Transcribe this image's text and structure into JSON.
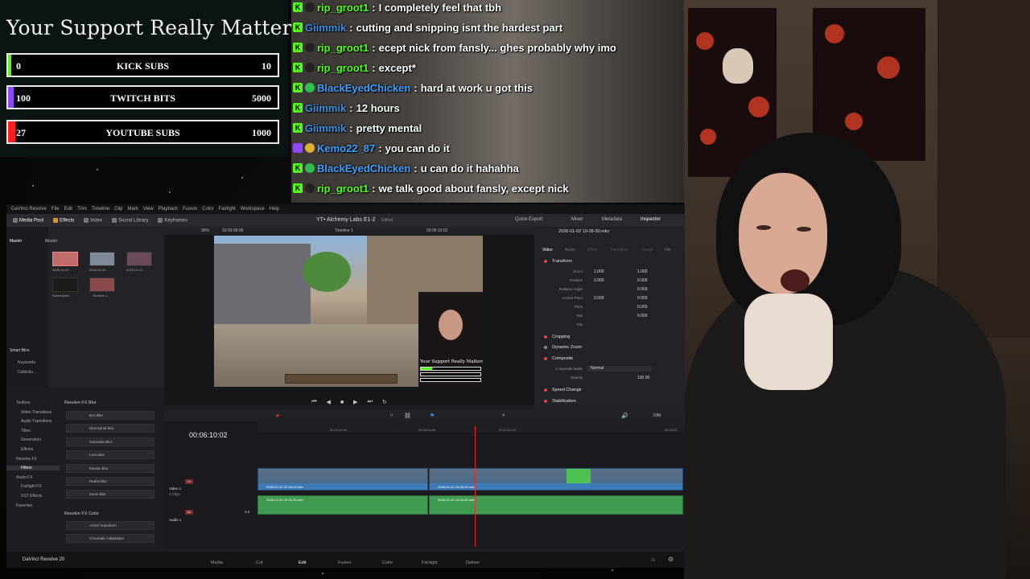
{
  "colors": {
    "kick_green": "#53fc18",
    "twitch_purple": "#9146ff",
    "youtube_red": "#ff2020",
    "resolve_bg": "#1f1f23",
    "clip_blue": "#3d7ab8",
    "clip_green": "#3f9a52",
    "playhead_red": "#e03030"
  },
  "goal": {
    "title": "Your Support Really Matters",
    "bars": [
      {
        "label": "KICK SUBS",
        "current": "0",
        "target": "10",
        "progress": 0.0
      },
      {
        "label": "TWITCH BITS",
        "current": "100",
        "target": "5000",
        "progress": 0.02
      },
      {
        "label": "YOUTUBE SUBS",
        "current": "27",
        "target": "1000",
        "progress": 0.027
      }
    ]
  },
  "chat": [
    {
      "user": "rip_groot1",
      "message": "I completely feel that tbh",
      "user_color": "#53fc18",
      "badge": "kick",
      "extra": "dark"
    },
    {
      "user": "Giimmik",
      "message": "cutting and snipping isnt the hardest part",
      "user_color": "#3c8fe0",
      "badge": "kick",
      "extra": ""
    },
    {
      "user": "rip_groot1",
      "message": "ecept nick from fansly... ghes probably why imo",
      "user_color": "#53fc18",
      "badge": "kick",
      "extra": "dark"
    },
    {
      "user": "rip_groot1",
      "message": "except*",
      "user_color": "#53fc18",
      "badge": "kick",
      "extra": "dark"
    },
    {
      "user": "BlackEyedChicken",
      "message": "hard at work u got this",
      "user_color": "#3fa0ff",
      "badge": "kick",
      "extra": "green"
    },
    {
      "user": "Giimmik",
      "message": "12 hours",
      "user_color": "#3c8fe0",
      "badge": "kick",
      "extra": ""
    },
    {
      "user": "Giimmik",
      "message": "pretty mental",
      "user_color": "#3c8fe0",
      "badge": "kick",
      "extra": ""
    },
    {
      "user": "Kemo22_87",
      "message": "you can do it",
      "user_color": "#3fa0ff",
      "badge": "twitch",
      "extra": "gold"
    },
    {
      "user": "BlackEyedChicken",
      "message": "u can do it hahahha",
      "user_color": "#3fa0ff",
      "badge": "kick",
      "extra": "green"
    },
    {
      "user": "rip_groot1",
      "message": "we talk good about fansly, except nick",
      "user_color": "#53fc18",
      "badge": "kick",
      "extra": "dark"
    }
  ],
  "resolve": {
    "app_name": "DaVinci Resolve",
    "menus": [
      "DaVinci Resolve",
      "File",
      "Edit",
      "Trim",
      "Timeline",
      "Clip",
      "Mark",
      "View",
      "Playback",
      "Fusion",
      "Color",
      "Fairlight",
      "Workspace",
      "Help"
    ],
    "toolbar": {
      "media_pool": "Media Pool",
      "effects": "Effects",
      "index": "Index",
      "sound_library": "Sound Library",
      "keyframes": "Keyframes",
      "project_title": "YT• Alchemy Labs E1-2",
      "project_state": "Edited",
      "quick_export": "Quick Export",
      "mixer": "Mixer",
      "metadata": "Metadata",
      "inspector": "Inspector"
    },
    "media_pool": {
      "bins": [
        "Master",
        "Smart Bins",
        "Keywords",
        "Collectio..."
      ],
      "master_label": "Master",
      "clips": [
        "2026-01-02...",
        "2026-01-02...",
        "2026-01-02...",
        "Screenshot...",
        "Timeline 1"
      ]
    },
    "viewer": {
      "zoom": "39%",
      "duration": "03:59:38:05",
      "timeline_name": "Timeline 1",
      "timecode": "00:06:10:02",
      "overlay_title": "Your Support Really Matters"
    },
    "inspector": {
      "file": "2026-01-02 19-28-30.mkv",
      "tabs": [
        "Video",
        "Audio",
        "Effect",
        "Transition",
        "Image",
        "File"
      ],
      "transform_title": "Transform",
      "zoom_label": "Zoom",
      "zoom_x": "1.000",
      "zoom_y": "1.000",
      "position_label": "Position",
      "position_x": "0.000",
      "position_y": "0.000",
      "rotation_label": "Rotation Angle",
      "rotation": "0.000",
      "anchor_label": "Anchor Point",
      "anchor_x": "0.000",
      "anchor_y": "0.000",
      "pitch_label": "Pitch",
      "pitch": "0.000",
      "yaw_label": "Yaw",
      "yaw": "0.000",
      "flip_label": "Flip",
      "cropping": "Cropping",
      "dynamic_zoom": "Dynamic Zoom",
      "composite": "Composite",
      "composite_mode_label": "Composite Mode",
      "composite_mode": "Normal",
      "opacity_label": "Opacity",
      "opacity": "100.00",
      "speed_change": "Speed Change",
      "stabilization": "Stabilization"
    },
    "effects_library": {
      "tree": [
        "Toolbox",
        "Video Transitions",
        "Audio Transitions",
        "Titles",
        "Generators",
        "Effects",
        "Resolve FX",
        "Filters",
        "Audio FX",
        "Fairlight FX",
        "VST Effects",
        "Favorites"
      ],
      "group1": "Resolve FX Blur",
      "items1": [
        "Box Blur",
        "Directional Blur",
        "Gaussian Blur",
        "Lens Blur",
        "Mosaic Blur",
        "Radial Blur",
        "Zoom Blur"
      ],
      "group2": "Resolve FX Color",
      "items2": [
        "ACES Transform",
        "Chromatic Adaptation"
      ]
    },
    "timeline": {
      "timecode": "00:06:10:02",
      "ruler": [
        "00:00:00:00",
        "00:06:00:00",
        "00:12:00:00",
        "00:18:00"
      ],
      "video_track": "Video 1",
      "video_track_tag": "V1",
      "video_clips_count": "4 Clips",
      "audio_track": "Audio 1",
      "audio_track_tag": "A1",
      "audio_level": "2.0",
      "clip_a": "2026-01-02 19-28-30.mkv",
      "clip_b": "2026-01-02 19-28-30.mkv",
      "zoom_label": "DIM"
    },
    "pages": [
      "Media",
      "Cut",
      "Edit",
      "Fusion",
      "Color",
      "Fairlight",
      "Deliver"
    ],
    "active_page": "Edit",
    "brand": "DaVinci Resolve 20"
  }
}
